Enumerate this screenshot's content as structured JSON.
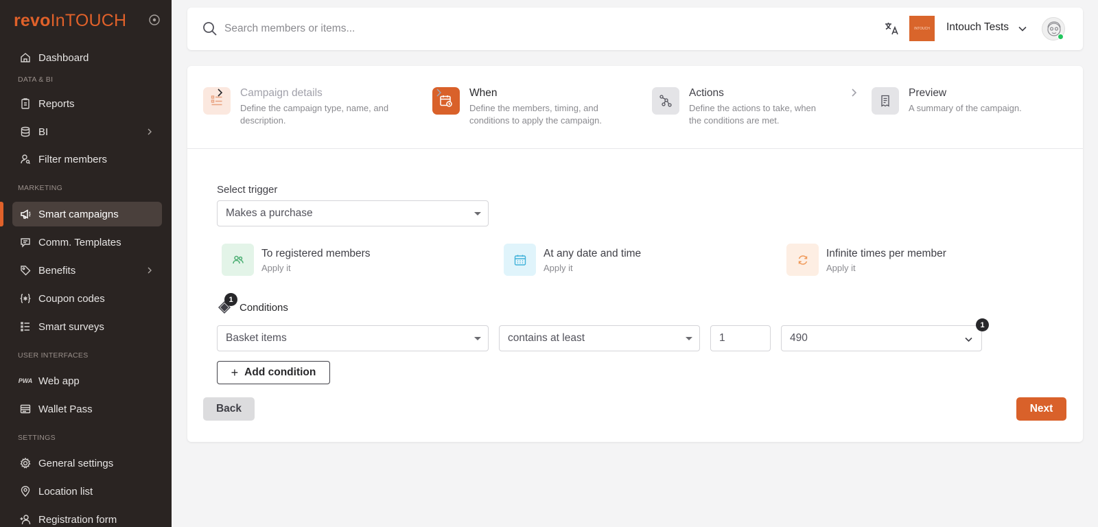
{
  "brand": {
    "logo_part1": "revo",
    "logo_part2": "InTOUCH",
    "accent": "#e0612a"
  },
  "sidebar": {
    "items": [
      {
        "label": "Dashboard",
        "icon": "home-icon"
      },
      {
        "label": "Reports",
        "icon": "report-icon"
      },
      {
        "label": "BI",
        "icon": "database-icon"
      },
      {
        "label": "Filter members",
        "icon": "user-search-icon"
      },
      {
        "label": "Smart campaigns",
        "icon": "megaphone-icon",
        "active": true
      },
      {
        "label": "Comm. Templates",
        "icon": "message-icon"
      },
      {
        "label": "Benefits",
        "icon": "tag-icon"
      },
      {
        "label": "Coupon codes",
        "icon": "coupon-icon"
      },
      {
        "label": "Smart surveys",
        "icon": "list-icon"
      },
      {
        "label": "Web app",
        "icon": "pwa-icon"
      },
      {
        "label": "Wallet Pass",
        "icon": "wallet-icon"
      },
      {
        "label": "General settings",
        "icon": "gear-icon"
      },
      {
        "label": "Location list",
        "icon": "pin-icon"
      },
      {
        "label": "Registration form",
        "icon": "user-plus-icon"
      }
    ],
    "sections": {
      "data_bi": "DATA & BI",
      "marketing": "MARKETING",
      "user_interfaces": "USER INTERFACES",
      "settings": "SETTINGS"
    },
    "pwa_glyph": "PWA"
  },
  "topbar": {
    "search_placeholder": "Search members or items...",
    "org_logo_text": "INTOUCH",
    "org_name": "Intouch Tests"
  },
  "steps": [
    {
      "title": "Campaign details",
      "desc1": "Define the campaign type, name, and",
      "desc2": "description."
    },
    {
      "title": "When",
      "desc1": "Define the members, timing, and",
      "desc2": "conditions to apply the campaign."
    },
    {
      "title": "Actions",
      "desc1": "Define the actions to take, when",
      "desc2": "the conditions are met."
    },
    {
      "title": "Preview",
      "desc1": "A summary of the campaign.",
      "desc2": ""
    }
  ],
  "form": {
    "trigger_label": "Select trigger",
    "trigger_value": "Makes a purchase",
    "features": [
      {
        "title": "To registered members",
        "sub": "Apply it"
      },
      {
        "title": "At any date and time",
        "sub": "Apply it"
      },
      {
        "title": "Infinite times per member",
        "sub": "Apply it"
      }
    ],
    "conditions_label": "Conditions",
    "conditions_count": "1",
    "condition": {
      "field": "Basket items",
      "operator": "contains at least",
      "quantity": "1",
      "item": "490",
      "item_badge": "1"
    },
    "add_condition": "Add condition",
    "back": "Back",
    "next": "Next"
  }
}
